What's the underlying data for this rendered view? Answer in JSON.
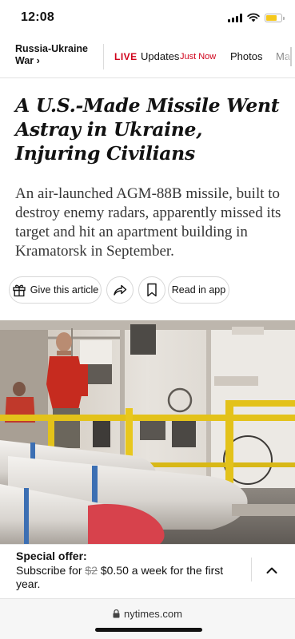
{
  "status_bar": {
    "time": "12:08",
    "signal_icon": "cellular-signal-icon",
    "wifi_icon": "wifi-icon",
    "battery_icon": "battery-icon",
    "battery_level": 0.7,
    "battery_color": "#f5c81c"
  },
  "nav": {
    "section_title": "Russia-Ukraine War ›",
    "live_label": "LIVE",
    "updates_label": "Updates",
    "just_now": "Just Now",
    "photos_label": "Photos",
    "more_label": "Ma",
    "live_color": "#d0021b"
  },
  "article": {
    "headline": "A U.S.-Made Missile Went Astray in Ukraine, Injuring Civilians",
    "summary": "An air-launched AGM-88B missile, built to destroy enemy radars, apparently missed its target and hit an apartment building in Kramatorsk in September."
  },
  "actions": {
    "gift_icon": "gift-icon",
    "gift_label": "Give this article",
    "share_icon": "share-icon",
    "save_icon": "bookmark-icon",
    "read_in_app_label": "Read in app"
  },
  "photo": {
    "description_icon": "missile-photo"
  },
  "offer": {
    "title": "Special offer:",
    "text_before": "Subscribe for ",
    "old_price": "$2",
    "text_after": " $0.50 a week for the first year.",
    "chevron_icon": "chevron-up-icon"
  },
  "browser": {
    "lock_icon": "lock-icon",
    "url": "nytimes.com"
  }
}
